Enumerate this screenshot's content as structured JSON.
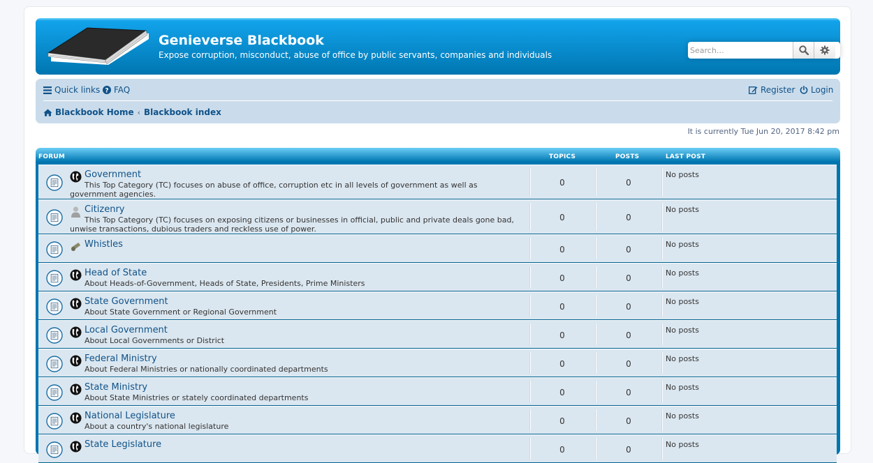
{
  "header": {
    "site_title": "Genieverse Blackbook",
    "site_description": "Expose corruption, misconduct, abuse of office by public servants, companies and individuals",
    "search_placeholder": "Search…"
  },
  "navbar": {
    "quick_links": "Quick links",
    "faq": "FAQ",
    "register": "Register",
    "login": "Login",
    "breadcrumbs": [
      "Blackbook Home",
      "Blackbook index"
    ]
  },
  "timestamp": "It is currently Tue Jun 20, 2017 8:42 pm",
  "forum_list": {
    "columns": {
      "forum": "FORUM",
      "topics": "TOPICS",
      "posts": "POSTS",
      "last_post": "LAST POST"
    },
    "rows": [
      {
        "icon": "globe-icon",
        "title": "Government",
        "description": "This Top Category (TC) focuses on abuse of office, corruption etc in all levels of government as well as government agencies.",
        "topics": "0",
        "posts": "0",
        "last_post": "No posts"
      },
      {
        "icon": "person-icon",
        "title": "Citizenry",
        "description": "This Top Category (TC) focuses on exposing citizens or businesses in official, public and private deals gone bad, unwise transactions, dubious traders and reckless use of power.",
        "topics": "0",
        "posts": "0",
        "last_post": "No posts"
      },
      {
        "icon": "whistle-icon",
        "title": "Whistles",
        "description": "",
        "topics": "0",
        "posts": "0",
        "last_post": "No posts"
      },
      {
        "icon": "globe-icon",
        "title": "Head of State",
        "description": "About Heads-of-Government, Heads of State, Presidents, Prime Ministers",
        "topics": "0",
        "posts": "0",
        "last_post": "No posts"
      },
      {
        "icon": "globe-icon",
        "title": "State Government",
        "description": "About State Government or Regional Government",
        "topics": "0",
        "posts": "0",
        "last_post": "No posts"
      },
      {
        "icon": "globe-icon",
        "title": "Local Government",
        "description": "About Local Governments or District",
        "topics": "0",
        "posts": "0",
        "last_post": "No posts"
      },
      {
        "icon": "globe-icon",
        "title": "Federal Ministry",
        "description": "About Federal Ministries or nationally coordinated departments",
        "topics": "0",
        "posts": "0",
        "last_post": "No posts"
      },
      {
        "icon": "globe-icon",
        "title": "State Ministry",
        "description": "About State Ministries or stately coordinated departments",
        "topics": "0",
        "posts": "0",
        "last_post": "No posts"
      },
      {
        "icon": "globe-icon",
        "title": "National Legislature",
        "description": "About a country's national legislature",
        "topics": "0",
        "posts": "0",
        "last_post": "No posts"
      },
      {
        "icon": "globe-icon",
        "title": "State Legislature",
        "description": "",
        "topics": "0",
        "posts": "0",
        "last_post": "No posts"
      }
    ]
  }
}
